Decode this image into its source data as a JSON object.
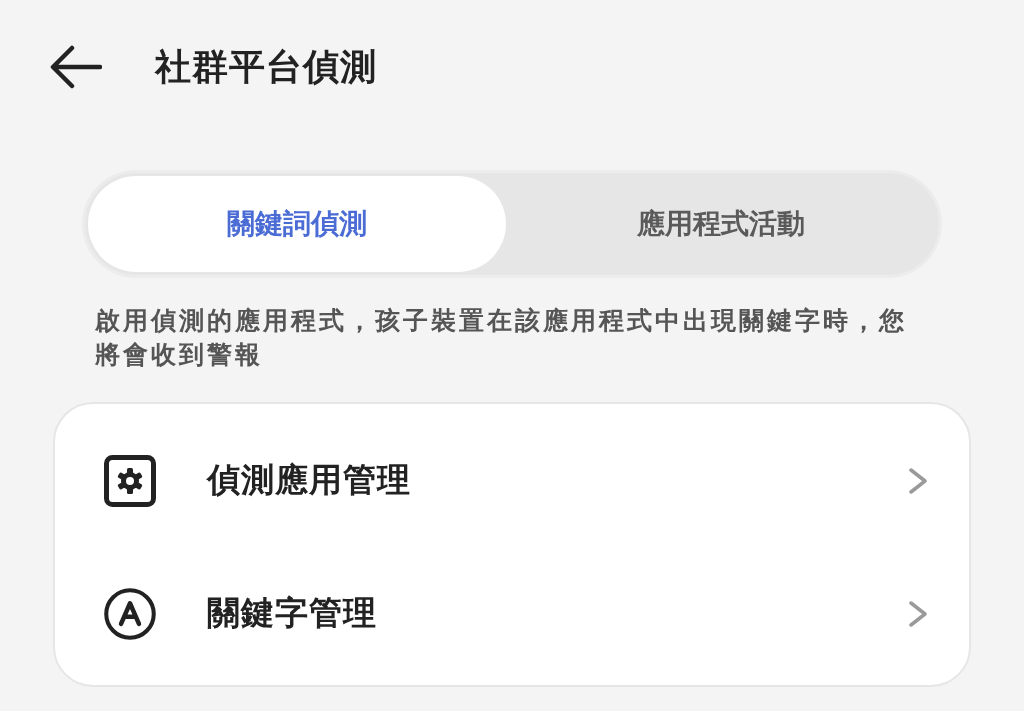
{
  "header": {
    "title": "社群平台偵測"
  },
  "tabs": [
    {
      "label": "關鍵詞偵測",
      "selected": true
    },
    {
      "label": "應用程式活動",
      "selected": false
    }
  ],
  "description": "啟用偵測的應用程式，孩子裝置在該應用程式中出現關鍵字時，您將會收到警報",
  "menu_items": [
    {
      "label": "偵測應用管理",
      "kind": "settings"
    },
    {
      "label": "關鍵字管理",
      "kind": "letter"
    }
  ]
}
